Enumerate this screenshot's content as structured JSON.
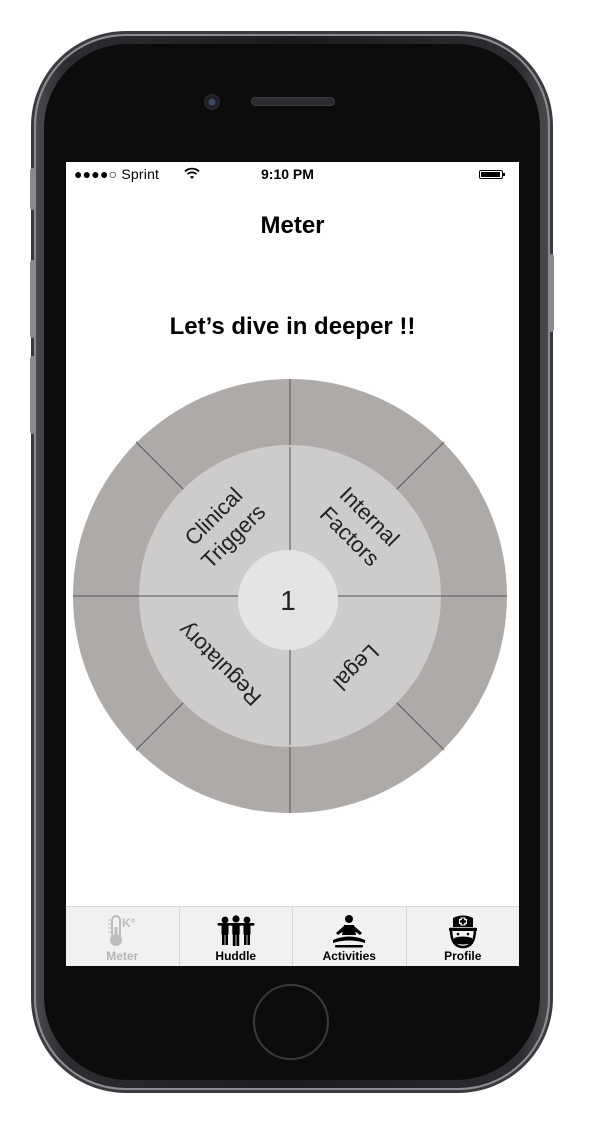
{
  "status_bar": {
    "carrier": "●●●●○ Sprint",
    "time": "9:10 PM"
  },
  "header": {
    "title": "Meter"
  },
  "main": {
    "subtitle": "Let’s dive in deeper !!",
    "wheel": {
      "center_value": "1",
      "segments": [
        {
          "line1": "Clinical",
          "line2": "Triggers"
        },
        {
          "line1": "Internal",
          "line2": "Factors"
        },
        {
          "line1": "Legal",
          "line2": ""
        },
        {
          "line1": "Regulatory",
          "line2": ""
        }
      ],
      "colors": {
        "outer_ring": "#aeaaa8",
        "inner_ring": "#cecccb",
        "center": "#e4e4e4",
        "divider": "#555555"
      }
    }
  },
  "tab_bar": {
    "items": [
      {
        "label": "Meter",
        "icon": "thermometer-icon",
        "active": false,
        "badge": "K°"
      },
      {
        "label": "Huddle",
        "icon": "group-icon",
        "active": true
      },
      {
        "label": "Activities",
        "icon": "meditation-icon",
        "active": true
      },
      {
        "label": "Profile",
        "icon": "nurse-icon",
        "active": true
      }
    ]
  }
}
